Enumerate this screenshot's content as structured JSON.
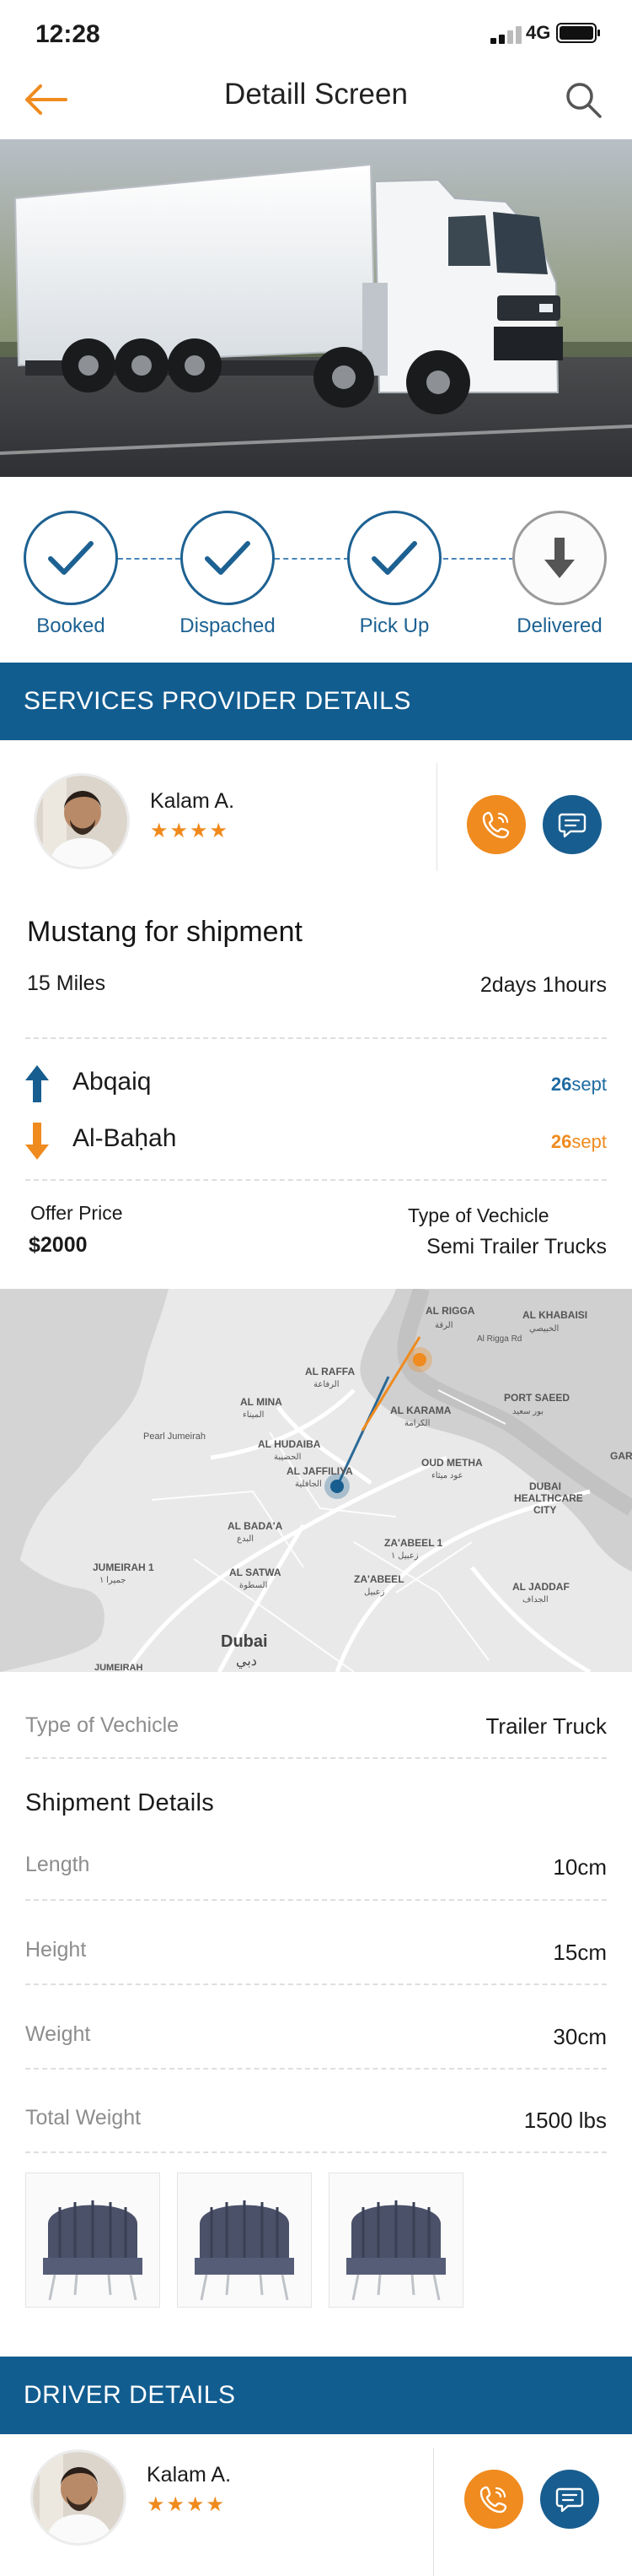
{
  "status_bar": {
    "time": "12:28",
    "network": "4G"
  },
  "header": {
    "title": "Detaill Screen"
  },
  "tracking": {
    "steps": [
      {
        "label": "Booked"
      },
      {
        "label": "Dispached"
      },
      {
        "label": "Pick Up"
      },
      {
        "label": "Delivered"
      }
    ]
  },
  "services_provider": {
    "heading": "SERVICES PROVIDER DETAILS",
    "name": "Kalam A.",
    "rating": 4,
    "stars": "★★★★"
  },
  "shipment_summary": {
    "title": "Mustang for shipment",
    "distance": "15 Miles",
    "duration": "2days 1hours",
    "origin": {
      "city": "Abqaiq",
      "date_num": "26",
      "date_month": "sept"
    },
    "destination": {
      "city": "Al-Baḥah",
      "date_num": "26",
      "date_month": "sept"
    },
    "offer_price_label": "Offer Price",
    "offer_price": "$2000",
    "vehicle_type_label": "Type of Vechicle",
    "vehicle_type": "Semi Trailer Trucks"
  },
  "map": {
    "labels": [
      "AL RIGGA",
      "الرقة",
      "AL KHABAISI",
      "الخبيصي",
      "Al Rigga Rd",
      "AL RAFFA",
      "الرفاعة",
      "AL MINA",
      "الميناء",
      "AL KARAMA",
      "الكرامة",
      "PORT SAEED",
      "بور سعيد",
      "GAR",
      "Pearl Jumeirah",
      "AL HUDAIBA",
      "الحضيبة",
      "AL JAFFILIYA",
      "الجافلية",
      "OUD METHA",
      "عود ميثاء",
      "DUBAI",
      "HEALTHCARE",
      "CITY",
      "AL BADA'A",
      "البدع",
      "ZA'ABEEL 1",
      "زعبيل ١",
      "JUMEIRAH 1",
      "جميرا ١",
      "AL SATWA",
      "السطوة",
      "ZA'ABEEL",
      "زعبيل",
      "AL JADDAF",
      "الجداف",
      "Dubai",
      "دبي",
      "JUMEIRAH"
    ]
  },
  "details": {
    "vehicle_label": "Type of Vechicle",
    "vehicle_value": "Trailer Truck",
    "shipment_heading": "Shipment Details",
    "rows": [
      {
        "label": "Length",
        "value": "10cm"
      },
      {
        "label": "Height",
        "value": "15cm"
      },
      {
        "label": "Weight",
        "value": "30cm"
      },
      {
        "label": "Total Weight",
        "value": "1500 lbs"
      }
    ]
  },
  "driver": {
    "heading": "DRIVER DETAILS",
    "name": "Kalam A.",
    "rating": 4,
    "stars": "★★★★"
  },
  "colors": {
    "primary": "#125d90",
    "accent": "#ef8b1f",
    "text": "#1b1b1b",
    "muted": "#8d8d8d"
  }
}
